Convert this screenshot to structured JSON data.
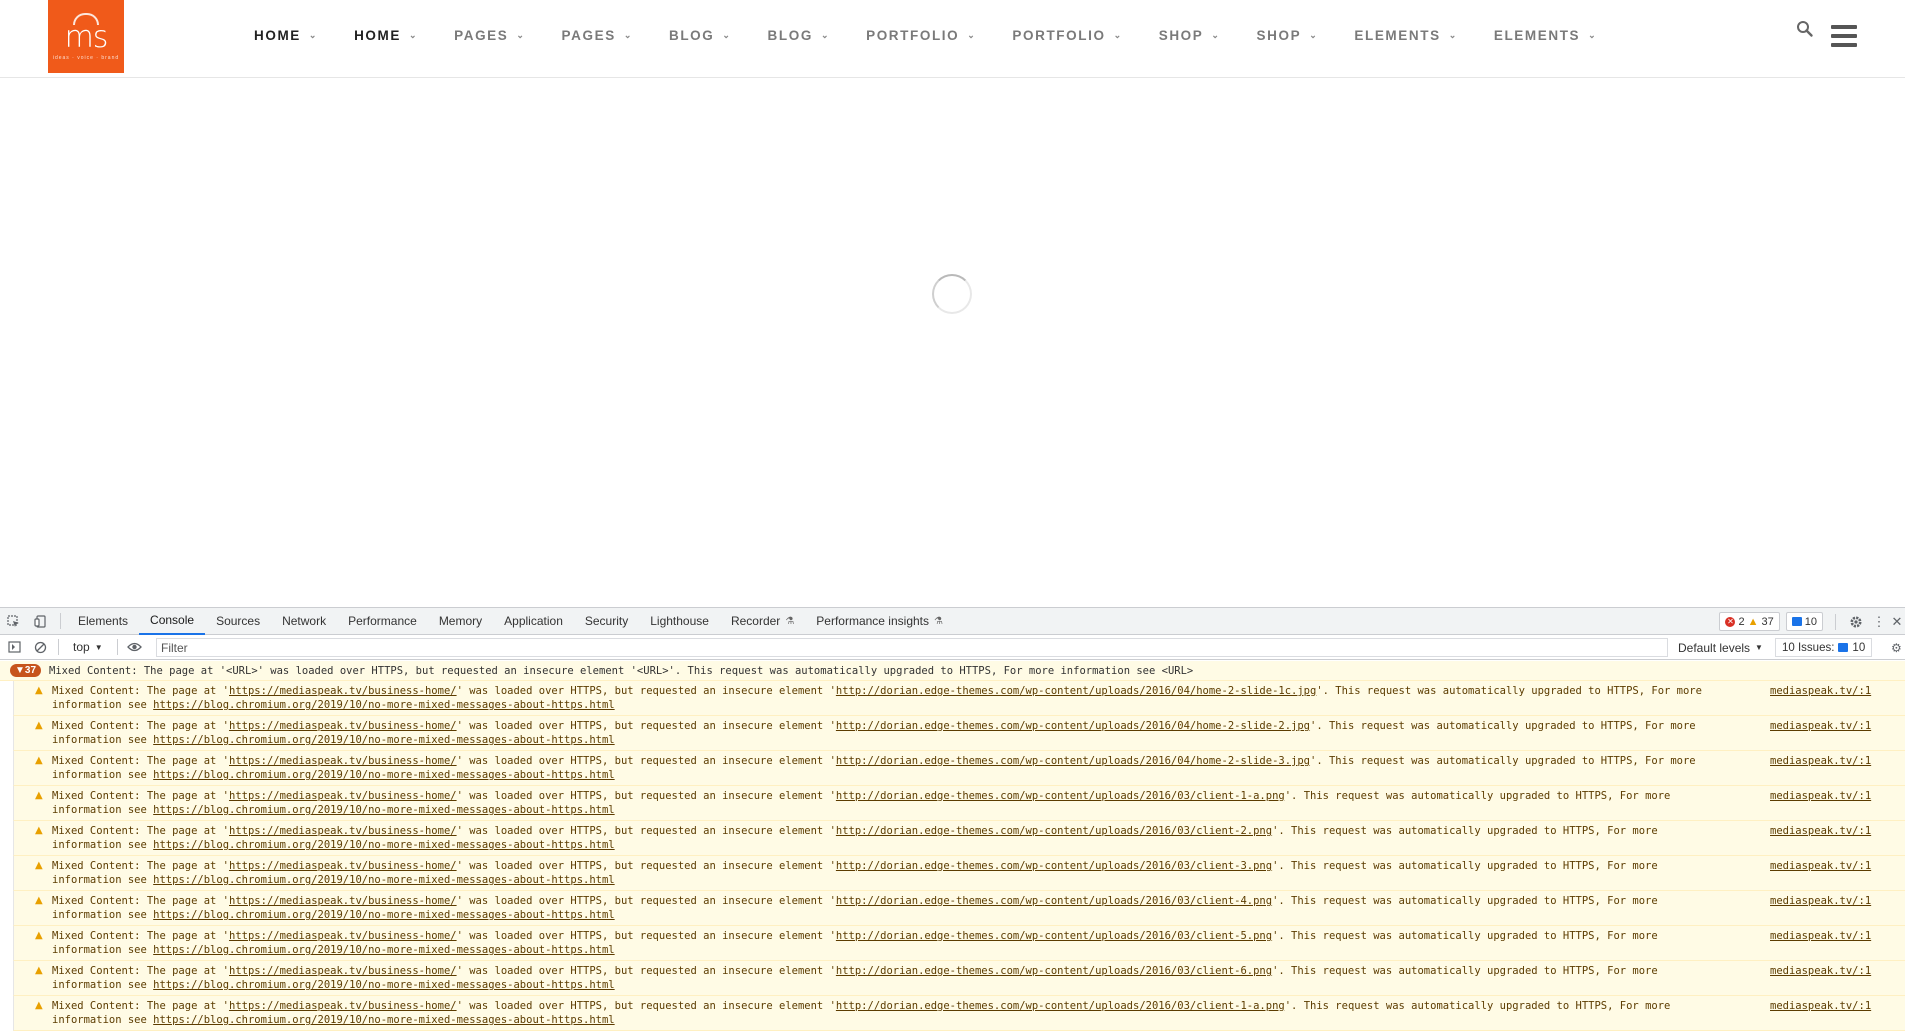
{
  "header": {
    "logo": {
      "text": "ms",
      "tagline": "ideas · voice · brand"
    },
    "nav": [
      {
        "label": "HOME",
        "active": true
      },
      {
        "label": "HOME",
        "active": true
      },
      {
        "label": "PAGES",
        "active": false
      },
      {
        "label": "PAGES",
        "active": false
      },
      {
        "label": "BLOG",
        "active": false
      },
      {
        "label": "BLOG",
        "active": false
      },
      {
        "label": "PORTFOLIO",
        "active": false
      },
      {
        "label": "PORTFOLIO",
        "active": false
      },
      {
        "label": "SHOP",
        "active": false
      },
      {
        "label": "SHOP",
        "active": false
      },
      {
        "label": "ELEMENTS",
        "active": false
      },
      {
        "label": "ELEMENTS",
        "active": false
      }
    ],
    "nav_chevron": "⌄",
    "accent_color": "#f05a1a"
  },
  "devtools": {
    "tabs": [
      {
        "label": "Elements",
        "experimental": false
      },
      {
        "label": "Console",
        "experimental": false,
        "active": true
      },
      {
        "label": "Sources",
        "experimental": false
      },
      {
        "label": "Network",
        "experimental": false
      },
      {
        "label": "Performance",
        "experimental": false
      },
      {
        "label": "Memory",
        "experimental": false
      },
      {
        "label": "Application",
        "experimental": false
      },
      {
        "label": "Security",
        "experimental": false
      },
      {
        "label": "Lighthouse",
        "experimental": false
      },
      {
        "label": "Recorder",
        "experimental": true
      },
      {
        "label": "Performance insights",
        "experimental": true
      }
    ],
    "counts": {
      "errors": "2",
      "warnings": "37",
      "messages": "10"
    },
    "toolbar": {
      "context": "top",
      "filter_placeholder": "Filter",
      "levels": "Default levels",
      "issues_label": "10 Issues:",
      "issues_count": "10"
    },
    "group": {
      "count": "37",
      "text": "Mixed Content: The page at '<URL>' was loaded over HTTPS, but requested an insecure element '<URL>'. This request was automatically upgraded to HTTPS, For more information see <URL>"
    },
    "message_parts": {
      "p1": "Mixed Content: The page at '",
      "page_url": "https://mediaspeak.tv/business-home/",
      "p2": "' was loaded over HTTPS, but requested an insecure element '",
      "p3": "'. This request was automatically upgraded to HTTPS, For ",
      "info_url": "https://blog.chromium.org/2019/10/no-more-mixed-messages-about-https.html",
      "source": "mediaspeak.tv/:1"
    },
    "messages": [
      {
        "element_url": "http://dorian.edge-themes.com/wp-content/uploads/2016/04/home-2-slide-1c.jpg",
        "tail1": "more",
        "tail2": "information see "
      },
      {
        "element_url": "http://dorian.edge-themes.com/wp-content/uploads/2016/04/home-2-slide-2.jpg",
        "tail1": "more",
        "tail2": "information see "
      },
      {
        "element_url": "http://dorian.edge-themes.com/wp-content/uploads/2016/04/home-2-slide-3.jpg",
        "tail1": "more",
        "tail2": "information see "
      },
      {
        "element_url": "http://dorian.edge-themes.com/wp-content/uploads/2016/03/client-1-a.png",
        "tail1": "more",
        "tail2": "information see "
      },
      {
        "element_url": "http://dorian.edge-themes.com/wp-content/uploads/2016/03/client-2.png",
        "tail1": "more",
        "tail2": "information see "
      },
      {
        "element_url": "http://dorian.edge-themes.com/wp-content/uploads/2016/03/client-3.png",
        "tail1": "more",
        "tail2": "information see "
      },
      {
        "element_url": "http://dorian.edge-themes.com/wp-content/uploads/2016/03/client-4.png",
        "tail1": "more",
        "tail2": "information see "
      },
      {
        "element_url": "http://dorian.edge-themes.com/wp-content/uploads/2016/03/client-5.png",
        "tail1": "more",
        "tail2": "information see "
      },
      {
        "element_url": "http://dorian.edge-themes.com/wp-content/uploads/2016/03/client-6.png",
        "tail1": "more",
        "tail2": "information see "
      },
      {
        "element_url": "http://dorian.edge-themes.com/wp-content/uploads/2016/03/client-1-a.png",
        "tail1": "more",
        "tail2": "information see "
      }
    ]
  }
}
